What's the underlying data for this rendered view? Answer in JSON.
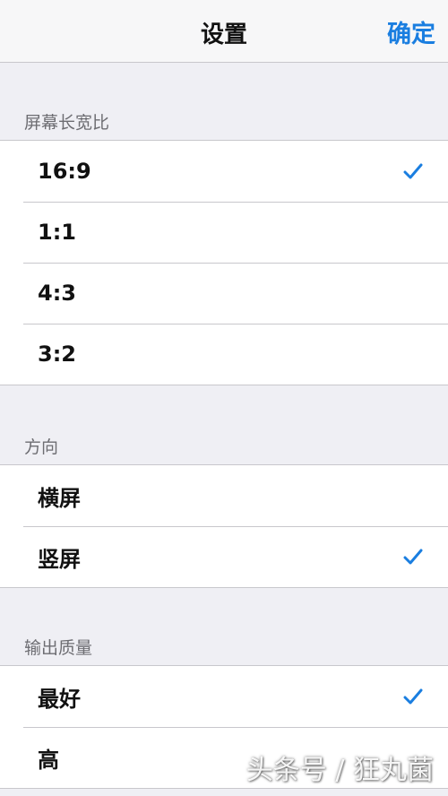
{
  "navbar": {
    "title": "设置",
    "confirm_label": "确定"
  },
  "accent_color": "#1a7ee0",
  "sections": [
    {
      "header": "屏幕长宽比",
      "options": [
        {
          "label": "16:9",
          "selected": true
        },
        {
          "label": "1:1",
          "selected": false
        },
        {
          "label": "4:3",
          "selected": false
        },
        {
          "label": "3:2",
          "selected": false
        }
      ]
    },
    {
      "header": "方向",
      "options": [
        {
          "label": "横屏",
          "selected": false
        },
        {
          "label": "竖屏",
          "selected": true
        }
      ]
    },
    {
      "header": "输出质量",
      "options": [
        {
          "label": "最好",
          "selected": true
        },
        {
          "label": "高",
          "selected": false
        }
      ]
    }
  ],
  "watermark": "头条号 / 狂丸菌",
  "icons": {
    "selected_marker": "checkmark-icon"
  }
}
